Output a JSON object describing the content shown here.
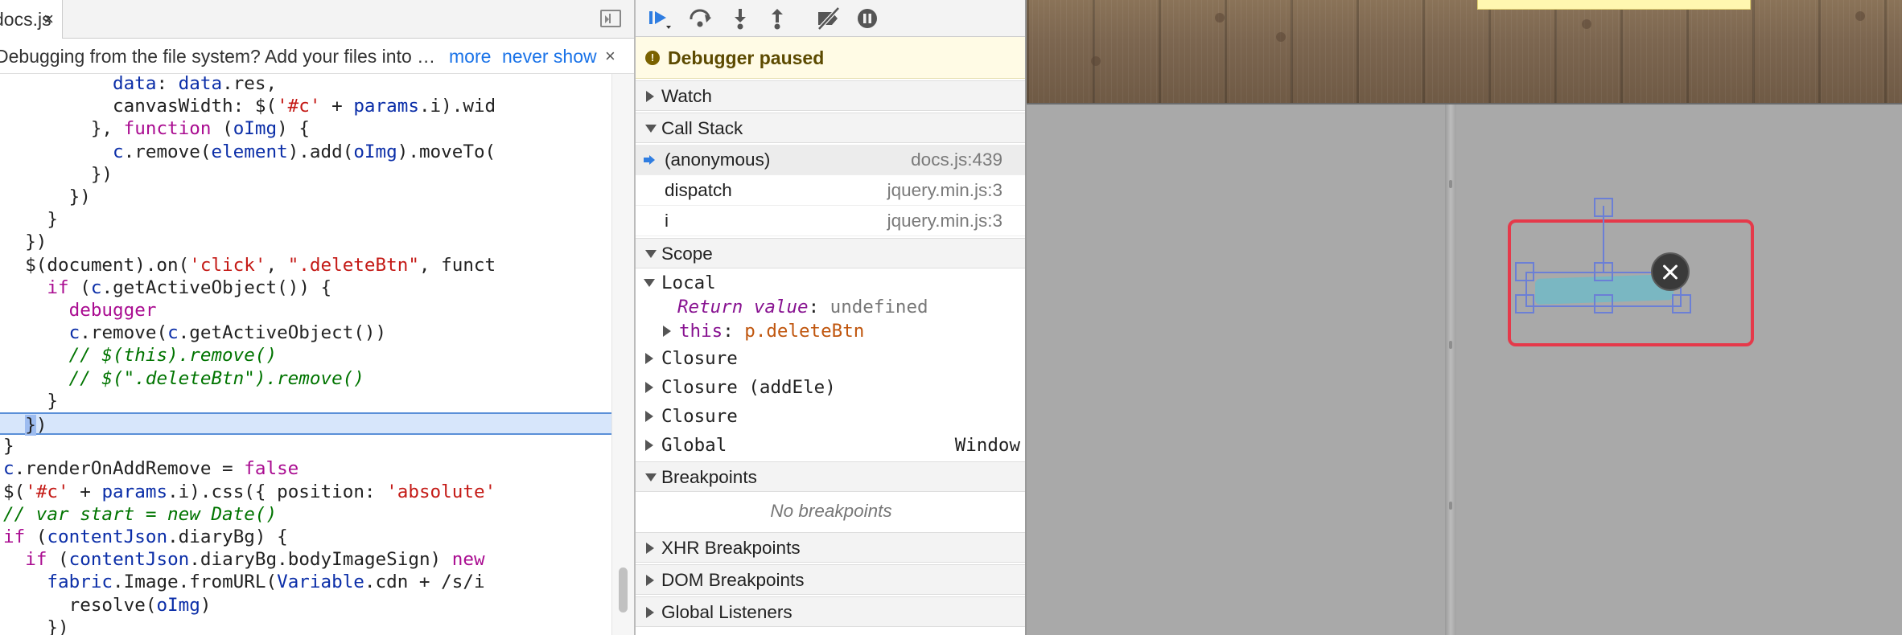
{
  "editor": {
    "tab": {
      "filename": "docs.js",
      "close": "×"
    },
    "infobar": {
      "message": "Debugging from the file system? Add your files into the workspace.",
      "more": "more",
      "never_show": "never show",
      "close": "×"
    },
    "lines": [
      "          data: data.res,",
      "          canvasWidth: $('#c' + params.i).wid",
      "        }, function (oImg) {",
      "          c.remove(element).add(oImg).moveTo(",
      "        })",
      "      })",
      "    }",
      "  })",
      "  $(document).on('click', \".deleteBtn\", funct",
      "    if (c.getActiveObject()) {",
      "      debugger",
      "      c.remove(c.getActiveObject())",
      "      // $(this).remove()",
      "      // $(\".deleteBtn\").remove()",
      "    }",
      "  })",
      "}",
      "c.renderOnAddRemove = false",
      "$('#c' + params.i).css({ position: 'absolute'",
      "// var start = new Date()",
      "if (contentJson.diaryBg) {",
      "  if (contentJson.diaryBg.bodyImageSign) new",
      "    fabric.Image.fromURL(Variable.cdn + '/s/i",
      "      resolve(oImg)",
      "    })"
    ]
  },
  "debugger": {
    "paused_label": "Debugger paused",
    "sections": {
      "watch": "Watch",
      "call_stack": "Call Stack",
      "scope": "Scope",
      "breakpoints": "Breakpoints",
      "xhr": "XHR Breakpoints",
      "dom": "DOM Breakpoints",
      "global_listeners": "Global Listeners"
    },
    "frames": [
      {
        "name": "(anonymous)",
        "loc": "docs.js:439"
      },
      {
        "name": "dispatch",
        "loc": "jquery.min.js:3"
      },
      {
        "name": "i",
        "loc": "jquery.min.js:3"
      }
    ],
    "scope": {
      "local": "Local",
      "return_name": "Return value",
      "return_val": "undefined",
      "this_name": "this",
      "this_val": "p.deleteBtn",
      "closure1": "Closure",
      "closure2": "Closure (addEle)",
      "closure3": "Closure",
      "global": "Global",
      "global_val": "Window",
      "colon": ":"
    },
    "no_breakpoints": "No breakpoints"
  },
  "icons": {
    "resume": "resume-icon",
    "step_over": "step-over-icon",
    "step_into": "step-into-icon",
    "step_out": "step-out-icon",
    "deactivate": "deactivate-breakpoints-icon",
    "pause_exceptions": "pause-on-exceptions-icon",
    "delete": "close-icon"
  },
  "colors": {
    "paused_bg": "#fffbe5",
    "selection_frame": "#e5394a",
    "control_border": "#6b7fd6",
    "object_fill": "#74b8c4"
  }
}
